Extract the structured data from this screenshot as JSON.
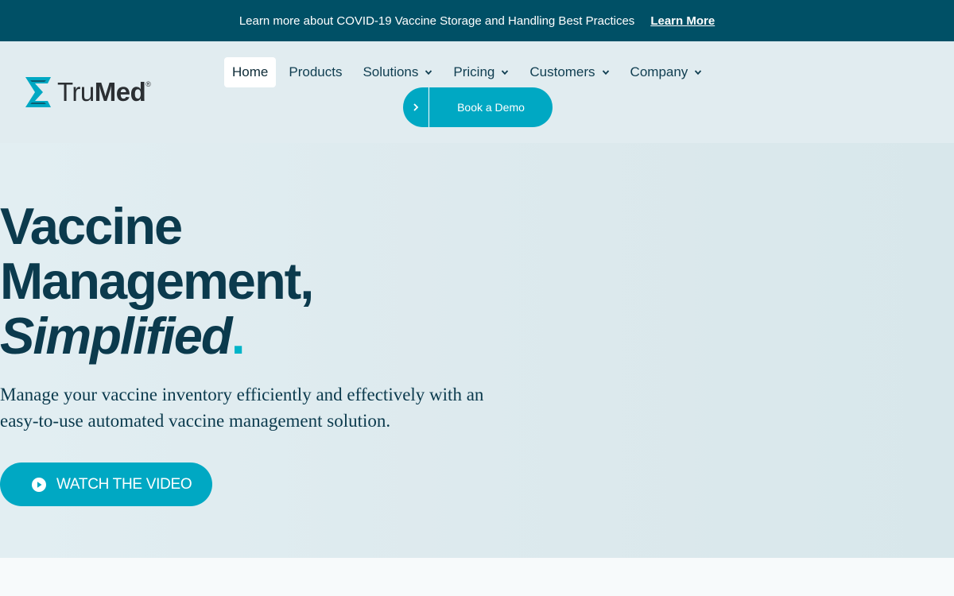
{
  "banner": {
    "message": "Learn more about COVID-19 Vaccine Storage and Handling Best Practices",
    "link": "Learn More"
  },
  "brand": {
    "name_light": "Tru",
    "name_bold": "Med",
    "registered": "®",
    "logo_icon": "hourglass-logo-icon"
  },
  "nav": {
    "items": [
      {
        "label": "Home",
        "active": true
      },
      {
        "label": "Products"
      },
      {
        "label": "Solutions",
        "dropdown": true
      },
      {
        "label": "Pricing",
        "dropdown": true
      },
      {
        "label": "Customers",
        "dropdown": true
      },
      {
        "label": "Company",
        "dropdown": true
      }
    ],
    "cta": "Book a Demo"
  },
  "hero": {
    "line1": "Vaccine",
    "line2": "Management,",
    "line3": "Simplified",
    "punct": ".",
    "subtext": "Manage your vaccine inventory efficiently and effectively with an easy-to-use automated vaccine management solution.",
    "video_button": "WATCH THE VIDEO"
  },
  "colors": {
    "banner_bg": "#005066",
    "accent": "#00a8c3",
    "heading": "#0b3a4d",
    "hero_bg": "#dce9ed"
  }
}
